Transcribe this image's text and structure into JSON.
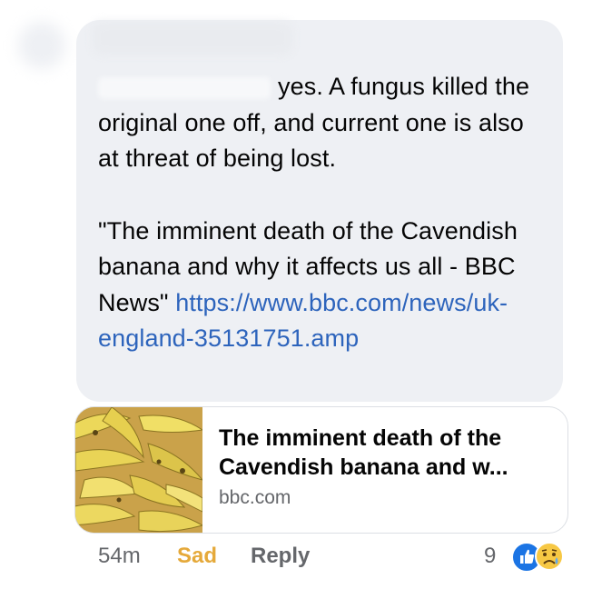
{
  "comment": {
    "author_redacted": "",
    "line_intro": "yes. A fungus killed the original one off, and current one is also at threat of being lost.",
    "quote": "\"The imminent death of the Cavendish banana and why it affects us all - BBC News\"",
    "link": "https://www.bbc.com/news/uk-england-35131751.amp"
  },
  "link_card": {
    "title": "The imminent death of the Cavendish banana and w...",
    "domain": "bbc.com",
    "thumbnail": "bananas-photo"
  },
  "footer": {
    "timestamp": "54m",
    "reaction_label": "Sad",
    "reply_label": "Reply",
    "reaction_count": "9",
    "reaction_icons": [
      "like-icon",
      "sad-face-icon"
    ]
  },
  "colors": {
    "bubble": "#eef0f4",
    "link": "#2d64bc",
    "sad": "#e5a93a",
    "like": "#1b74e4"
  }
}
